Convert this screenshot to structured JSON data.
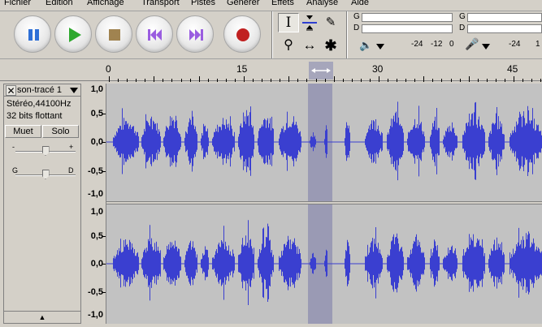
{
  "menu": [
    "Fichier",
    "Edition",
    "Affichage",
    "Transport",
    "Pistes",
    "Générer",
    "Effets",
    "Analyse",
    "Aide"
  ],
  "transport": {
    "buttons": [
      {
        "name": "pause-button",
        "icon": "pause-icon",
        "color": "#2e6fd6"
      },
      {
        "name": "play-button",
        "icon": "play-icon",
        "color": "#2ea82e"
      },
      {
        "name": "stop-button",
        "icon": "stop-icon",
        "color": "#a08350"
      },
      {
        "name": "skip-to-start-button",
        "icon": "skip-to-start-icon",
        "color": "#9a5de0"
      },
      {
        "name": "skip-to-end-button",
        "icon": "skip-to-end-icon",
        "color": "#9a5de0"
      },
      {
        "name": "record-button",
        "icon": "record-icon",
        "color": "#c02020"
      }
    ]
  },
  "tools": {
    "selection": "I",
    "timeshift": "↔",
    "multi": "✱",
    "zoom": "⚲",
    "draw": "✎"
  },
  "meters": {
    "playback": {
      "left": "G",
      "right": "D",
      "ticks": [
        "-24",
        "-12",
        "0"
      ]
    },
    "record": {
      "left": "G",
      "right": "D",
      "ticks": [
        "-24",
        "1"
      ]
    }
  },
  "ruler": {
    "labels": [
      "0",
      "15",
      "30",
      "45"
    ]
  },
  "track": {
    "name": "son-tracé 1",
    "format": "Stéréo,44100Hz",
    "bits": "32 bits flottant",
    "mute_label": "Muet",
    "solo_label": "Solo",
    "gain_minus": "-",
    "gain_plus": "+",
    "pan_left": "G",
    "pan_right": "D",
    "collapse": "▲",
    "gain_level": 0.5,
    "pan_level": 0.5
  },
  "scale": {
    "channel1": [
      "1,0",
      "0,5",
      "0,0",
      "-0,5",
      "-1,0"
    ],
    "channel2": [
      "1,0",
      "0,5",
      "0,0",
      "-0,5",
      "-1,0"
    ]
  },
  "colors": {
    "waveform": "#3a3fd0",
    "wave_bg": "#c2c2c2",
    "selection": "#9a9ab4",
    "centerline": "#3a3fd0"
  }
}
